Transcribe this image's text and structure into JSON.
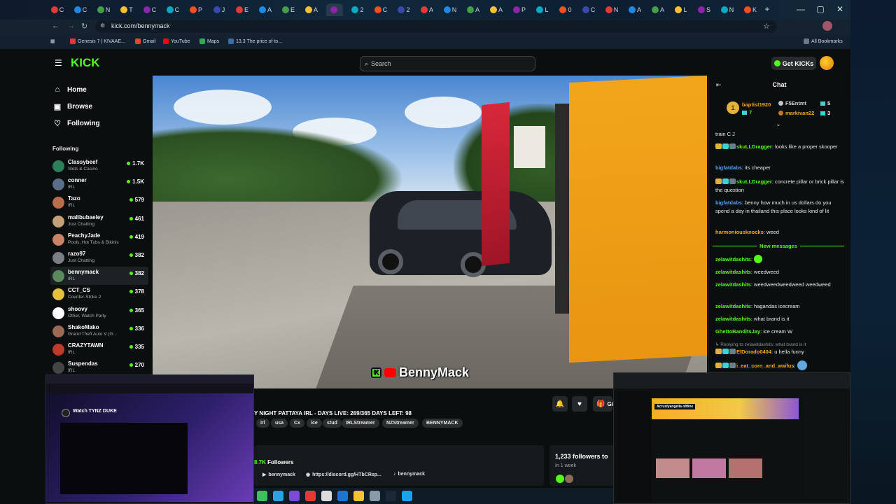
{
  "browser": {
    "url": "kick.com/bennymack",
    "tabs": [
      "C",
      "C",
      "N",
      "T",
      "C",
      "C",
      "P",
      "J",
      "E",
      "A",
      "E",
      "A",
      "",
      "2",
      "C",
      "2",
      "A",
      "N",
      "A",
      "A",
      "P",
      "L",
      "0",
      "C",
      "N",
      "A",
      "A",
      "L",
      "S",
      "N",
      "K"
    ],
    "bookmarks": [
      "Genesis 7 | KIVAAE...",
      "Gmail",
      "YouTube",
      "Maps",
      "13.3 The price of to..."
    ],
    "all_bookmarks": "All Bookmarks",
    "new_tab": "+",
    "minimize": "—",
    "maximize": "▢",
    "close": "✕"
  },
  "header": {
    "logo": "KICK",
    "search_placeholder": "Search",
    "get_kicks": "Get KICKs"
  },
  "nav": {
    "home": "Home",
    "browse": "Browse",
    "following": "Following"
  },
  "following": {
    "title": "Following",
    "channels": [
      {
        "name": "Classybeef",
        "category": "Slots & Casino",
        "viewers": "1.7K",
        "color": "#2e7d5b"
      },
      {
        "name": "conner",
        "category": "IRL",
        "viewers": "1.5K",
        "color": "#5a6e8a"
      },
      {
        "name": "Tazo",
        "category": "IRL",
        "viewers": "579",
        "color": "#b86e4a"
      },
      {
        "name": "malibubaeley",
        "category": "Just Chatting",
        "viewers": "461",
        "color": "#c4a07a"
      },
      {
        "name": "PeachyJade",
        "category": "Pools, Hot Tubs & Bikinis",
        "viewers": "419",
        "color": "#c98268"
      },
      {
        "name": "razo97",
        "category": "Just Chatting",
        "viewers": "382",
        "color": "#7a7f86"
      },
      {
        "name": "bennymack",
        "category": "IRL",
        "viewers": "382",
        "color": "#5b8a5e"
      },
      {
        "name": "CCT_CS",
        "category": "Counter-Strike 2",
        "viewers": "378",
        "color": "#e3c23a"
      },
      {
        "name": "shoovy",
        "category": "Other, Watch Party",
        "viewers": "365",
        "color": "#ffffff"
      },
      {
        "name": "ShakoMako",
        "category": "Grand Theft Auto V (G...",
        "viewers": "336",
        "color": "#9a6a55"
      },
      {
        "name": "CRAZYTAWN",
        "category": "IRL",
        "viewers": "335",
        "color": "#c0392b"
      },
      {
        "name": "Suspendas",
        "category": "IRL",
        "viewers": "270",
        "color": "#444"
      }
    ]
  },
  "stream": {
    "watermark": "BennyMack",
    "title": "Y NIGHT PATTAYA IRL - DAYS LIVE: 269/365 DAYS LEFT: 98",
    "tags": [
      "Irl",
      "usa",
      "Cx",
      "ice",
      "stud",
      "IRLStreamer",
      "NZStreamer",
      "BENNYMACK"
    ],
    "followers_value": "8.7K",
    "followers_label": "Followers",
    "social_1": "bennymack",
    "social_2": "https://discord.gg/HTbCRsp...",
    "social_3": "bennymack",
    "followers_week": "1,233 followers to",
    "week_label": "In 1 week",
    "gift_label": "Gi"
  },
  "chat": {
    "title": "Chat",
    "gifters": [
      {
        "name": "baptist1920",
        "count": "7"
      },
      {
        "name": "F5Entmt",
        "count": "5"
      },
      {
        "name": "markivan22",
        "count": "3"
      }
    ],
    "messages_before": [
      {
        "user": "",
        "text": "train C J",
        "color": "#ffffff"
      },
      {
        "user": "skuLLDragger",
        "text": ": looks like a proper skooper",
        "color": "#53fc18"
      },
      {
        "user": "bigfatdabs",
        "text": ": its cheaper",
        "color": "#4fa3ff"
      },
      {
        "user": "skuLLDragger",
        "text": ": concrete pillar or brick pillar is the question",
        "color": "#53fc18"
      },
      {
        "user": "bigfatdabs",
        "text": ": benny how much in us dollars do you spend a day in thailand this place looks kind of lit",
        "color": "#4fa3ff"
      },
      {
        "user": "harmoniousknocks",
        "text": ": weed",
        "color": "#f5a623"
      }
    ],
    "new_messages": "New messages",
    "messages_after": [
      {
        "user": "zelawitdashits",
        "text": ":",
        "color": "#53fc18"
      },
      {
        "user": "zelawitdashits",
        "text": ": weedweed",
        "color": "#53fc18"
      },
      {
        "user": "zelawitdashits",
        "text": ": weedweedweedweed weedweed",
        "color": "#53fc18"
      },
      {
        "user": "zelawitdashits",
        "text": ": hagandas icecream",
        "color": "#53fc18"
      },
      {
        "user": "zelawitdashits",
        "text": ": what brand is it",
        "color": "#53fc18"
      },
      {
        "user": "GhettoBanditsJay",
        "text": ": ice cream W",
        "color": "#53fc18"
      }
    ],
    "reply_context": "Replying to zelawitdashits: what brand is it",
    "reply_user": "ElDorado0404",
    "reply_text": ": u hella funny",
    "last_user": "i_eat_corn_and_waifus",
    "last_text": ":"
  },
  "overlay_left": {
    "title": "Watch TYNZ DUKE"
  },
  "overlay_right": {
    "banner": "AcrusfyangelIa offline"
  }
}
